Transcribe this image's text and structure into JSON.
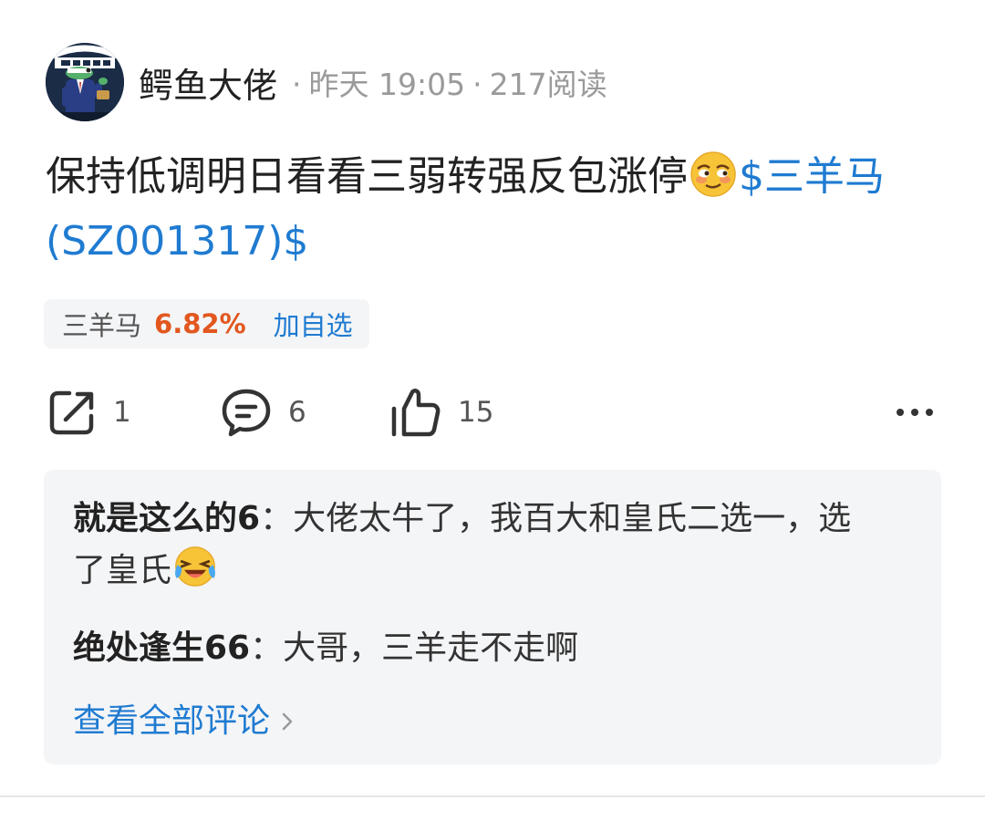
{
  "author": {
    "name": "鳄鱼大佬",
    "avatar_text": "CROCODILE LAWYER",
    "avatar_icon": "crocodile-lawyer-avatar"
  },
  "meta": {
    "time": "昨天 19:05",
    "reads": "217阅读",
    "separator": "·"
  },
  "post": {
    "text": "保持低调明日看看三弱转强反包涨停",
    "emoji": "smirk-face-emoji",
    "stock_link": "$三羊马(SZ001317)$"
  },
  "stock_chip": {
    "name": "三羊马",
    "change": "6.82%",
    "add_label": "加自选",
    "change_color": "#e2571e"
  },
  "actions": {
    "share_count": "1",
    "comment_count": "6",
    "like_count": "15",
    "share_icon": "share-icon",
    "comment_icon": "comment-icon",
    "like_icon": "thumbs-up-icon",
    "more_icon": "more-icon"
  },
  "comments": [
    {
      "user": "就是这么的6",
      "separator": "：",
      "text_a": "大佬太牛了，我百大和皇氏二选一，选了皇氏",
      "emoji": "tears-of-joy-emoji"
    },
    {
      "user": "绝处逢生66",
      "separator": "：",
      "text_a": "大哥，三羊走不走啊"
    }
  ],
  "view_all_label": "查看全部评论",
  "colors": {
    "link": "#1f7bd1",
    "muted": "#9a9a9a",
    "panel_bg": "#f4f5f7"
  }
}
